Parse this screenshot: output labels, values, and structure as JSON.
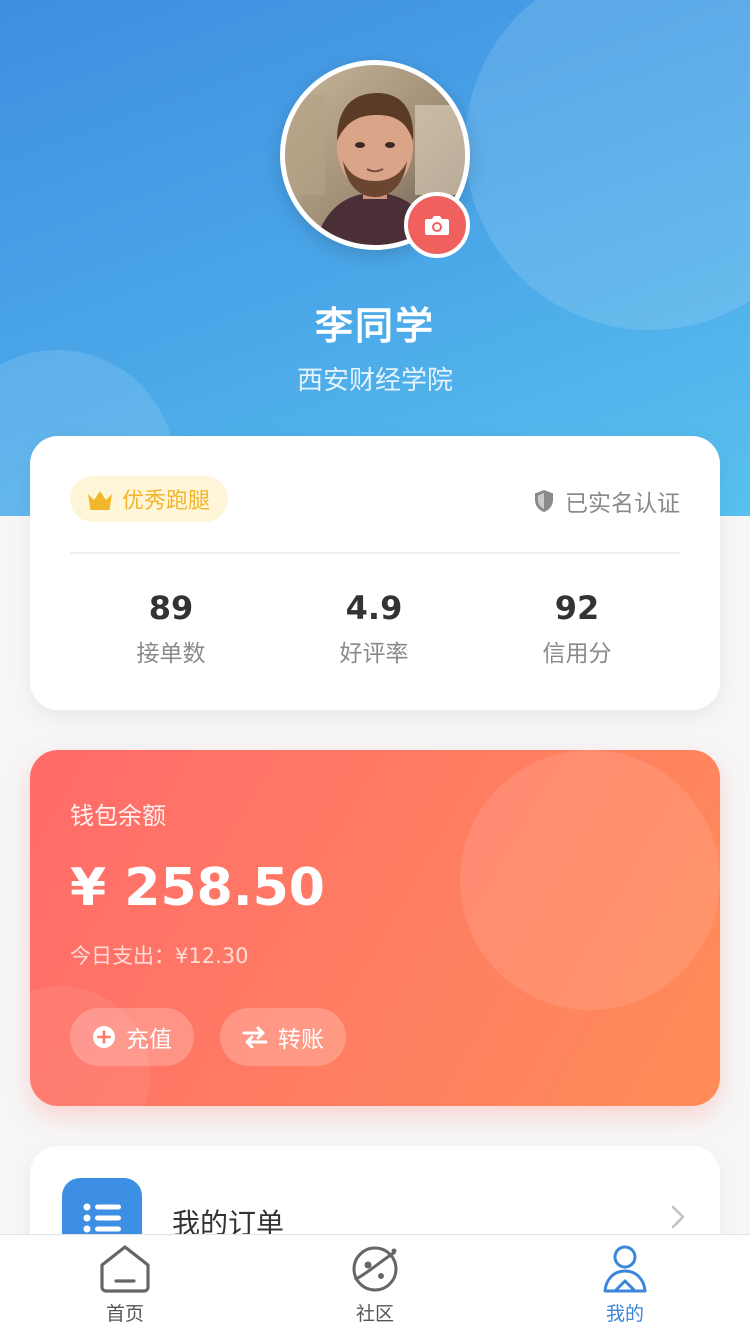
{
  "profile": {
    "name": "李同学",
    "school": "西安财经学院"
  },
  "stats_card": {
    "badge": "优秀跑腿",
    "verify": "已实名认证",
    "stats": [
      {
        "value": "89",
        "label": "接单数"
      },
      {
        "value": "4.9",
        "label": "好评率"
      },
      {
        "value": "92",
        "label": "信用分"
      }
    ]
  },
  "wallet": {
    "title": "钱包余额",
    "amount": "¥ 258.50",
    "today": "今日支出：¥12.30",
    "recharge": "充值",
    "transfer": "转账"
  },
  "menu": {
    "orders": "我的订单"
  },
  "tabbar": {
    "items": [
      {
        "label": "首页",
        "icon": "home-icon"
      },
      {
        "label": "社区",
        "icon": "planet-icon"
      },
      {
        "label": "我的",
        "icon": "user-icon"
      }
    ],
    "active": "我的"
  },
  "colors": {
    "header_gradient": [
      "#3f8fe0",
      "#58c1ee"
    ],
    "wallet_gradient": [
      "#ff6b6a",
      "#ff8d58"
    ],
    "accent_blue": "#3a86d8",
    "camera_red": "#f0605f",
    "badge_gold": "#f2b62a"
  }
}
